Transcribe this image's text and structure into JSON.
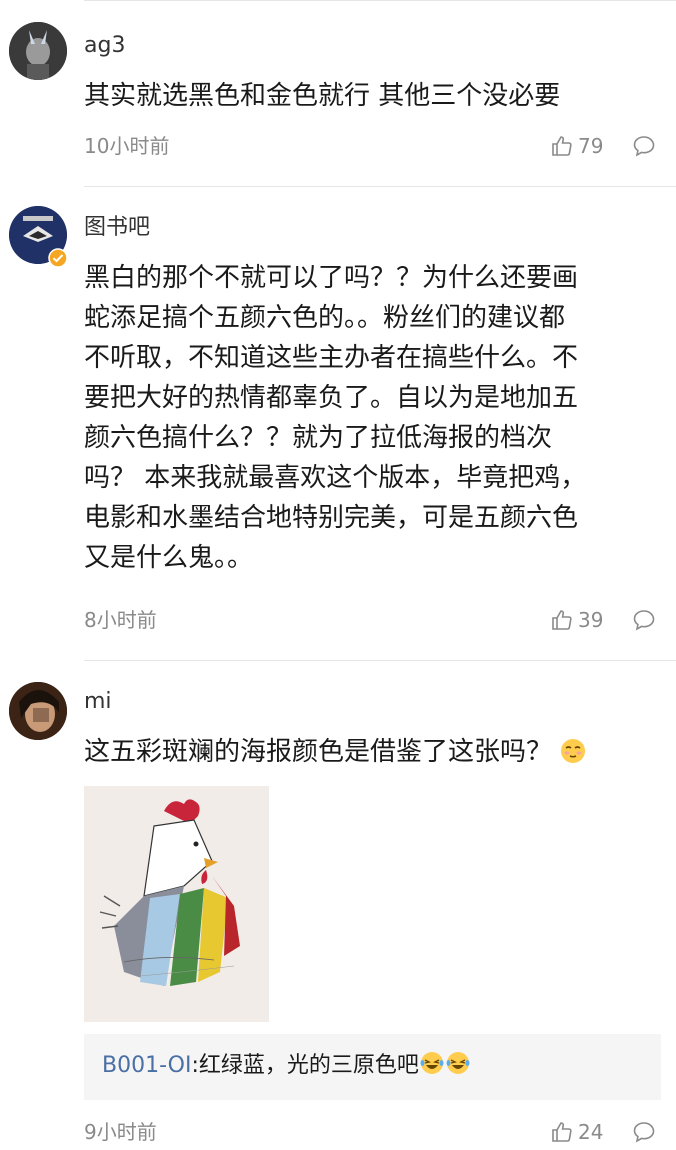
{
  "comments": [
    {
      "username": "ag3",
      "text": "其实就选黑色和金色就行 其他三个没必要",
      "time": "10小时前",
      "likes": "79"
    },
    {
      "username": "图书吧",
      "text_lines": [
        "黑白的那个不就可以了吗？？为什么还要画",
        "蛇添足搞个五颜六色的。。粉丝们的建议都",
        "不听取，不知道这些主办者在搞些什么。不",
        "要把大好的热情都辜负了。自以为是地加五",
        "颜六色搞什么？？就为了拉低海报的档次",
        "吗？ 本来我就最喜欢这个版本，毕竟把鸡，",
        "电影和水墨结合地特别完美，可是五颜六色",
        "又是什么鬼。。"
      ],
      "time": "8小时前",
      "likes": "39"
    },
    {
      "username": "mi",
      "text": "这五彩斑斓的海报颜色是借鉴了这张吗？",
      "reply": {
        "name": "B001-OI",
        "text": ":红绿蓝，光的三原色吧"
      },
      "time": "9小时前",
      "likes": "24"
    }
  ],
  "icons": {
    "like": "thumbs-up-icon",
    "reply": "speech-bubble-icon",
    "verified": "verified-badge-icon",
    "emoji_shy": "shy-face-emoji",
    "emoji_laugh": "laughing-tears-emoji"
  }
}
